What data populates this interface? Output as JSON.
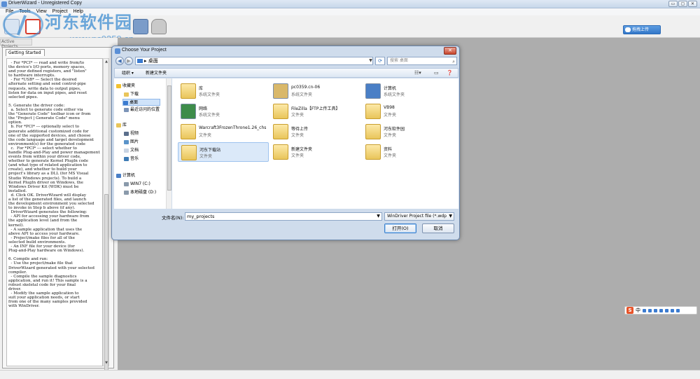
{
  "window": {
    "title": "DriverWizard - Unregistered Copy",
    "controls": [
      "▭",
      "▢",
      "✕"
    ]
  },
  "menu": [
    "File",
    "Tools",
    "View",
    "Project",
    "Help"
  ],
  "watermark": {
    "text": "河东软件园",
    "url": "www.pc0359.cn"
  },
  "toolbar": {
    "upload_label": "拖拽上传"
  },
  "left_panel": {
    "active_projects_tab": "Active Projects",
    "getting_started_tab": "Getting Started",
    "text_lines": [
      "  - For *PCI* --- read and write from/to",
      "the device's I/O ports, memory spaces,",
      "and your defined registers, and \"listen\"",
      "to hardware interrupts.",
      "  - For *USB* --- Select the desired",
      "alternate setting and send control-pipe",
      "requests, write data to output pipes,",
      "listen for data on input pipes, and reset",
      "selected pipes.",
      "",
      "5. Generate the driver code:",
      "  a. Select to generate code either via",
      "the \"Generate Code\" toolbar icon or from",
      "the \"Project | Generate Code\" menu",
      "option.",
      "  b. For *PCI* --- optionally select to",
      "generate additional customized code for",
      "one of the supported devices, and choose",
      "the code language and target development",
      "environment(s) for the generated code",
      "  c.  For *PCI* --- select whether to",
      "handle Plug-and-Play and power management",
      "events from within your driver code,",
      "whether to generate Kernel PlugIn code",
      "(and what type of related application to",
      "create), and whether to build your",
      "project's library as a DLL (for MS Visual",
      "Studio Windows projects). To build a",
      "Kernel PlugIn driver on Windows, the",
      "Windows Driver Kit (WDK) must be",
      "installed.",
      "  d. Click OK. DriverWizard will display",
      "a list of the generated files, and launch",
      "the development environment you selected",
      "to invoke in Step b above (if any).",
      "  DriverWizard generates the following:",
      "  - API for accessing your hardware from",
      "the application level (and from the",
      "kernel).",
      "  - A sample application that uses the",
      "above API to access your hardware.",
      "  - Project/make files for all of the",
      "selected build environments.",
      "  - An INF file for your device (for",
      "Plug-and-Play hardware on Windows).",
      "",
      "6. Compile and run:",
      "  - Use the project/make file that",
      "DriverWizard generated with your selected",
      "compiler.",
      "  - Compile the sample diagnostics",
      "application, and run it! This sample is a",
      "robust skeletal code for your final",
      "driver.",
      "  - Modify the sample application to",
      "suit your application needs, or start",
      "from one of the many samples provided",
      "with WinDriver."
    ]
  },
  "dialog": {
    "title": "Choose Your Project",
    "address": "桌面",
    "address_sep": "▸",
    "search_placeholder": "搜索 桌面",
    "organize": "组织 ▾",
    "new_folder": "新建文件夹",
    "nav": {
      "favorites": "收藏夹",
      "downloads": "下载",
      "desktop": "桌面",
      "recent": "最近访问的位置",
      "libraries": "库",
      "videos": "视频",
      "pictures": "图片",
      "documents": "文档",
      "music": "音乐",
      "computer": "计算机",
      "win7": "WIN7 (C:)",
      "localdisk": "本地磁盘 (D:)"
    },
    "files": [
      {
        "name": "库",
        "type": "系统文件夹",
        "icon": "library-icon",
        "color": "#e9c55a"
      },
      {
        "name": "pc0359.cn-06",
        "type": "系统文件夹",
        "icon": "user-folder-icon",
        "color": "#d9b86a"
      },
      {
        "name": "计算机",
        "type": "系统文件夹",
        "icon": "computer-icon",
        "color": "#4a7fc6"
      },
      {
        "name": "网络",
        "type": "系统文件夹",
        "icon": "network-icon",
        "color": "#3d8c4a"
      },
      {
        "name": "FileZilla【FTP上传工具】",
        "type": "文件夹",
        "icon": "folder-icon",
        "color": "#e9c55a"
      },
      {
        "name": "VB98",
        "type": "文件夹",
        "icon": "folder-icon",
        "color": "#e9c55a"
      },
      {
        "name": "Warcraft3FrozenThrone1.26_chs",
        "type": "文件夹",
        "icon": "folder-icon",
        "color": "#e9c55a"
      },
      {
        "name": "等待上传",
        "type": "文件夹",
        "icon": "folder-icon",
        "color": "#e9c55a"
      },
      {
        "name": "河东软件园",
        "type": "文件夹",
        "icon": "folder-icon",
        "color": "#e9c55a"
      },
      {
        "name": "河东下载站",
        "type": "文件夹",
        "icon": "folder-icon",
        "color": "#e9c55a"
      },
      {
        "name": "新建文件夹",
        "type": "文件夹",
        "icon": "folder-icon",
        "color": "#e9c55a"
      },
      {
        "name": "资料",
        "type": "文件夹",
        "icon": "folder-icon",
        "color": "#e9c55a"
      }
    ],
    "filename_label": "文件名(N):",
    "filename_value": "my_projects",
    "filetype": "WinDriver Project file (*.wdp",
    "open": "打开(O)",
    "cancel": "取消"
  },
  "ime": {
    "label": "中"
  }
}
